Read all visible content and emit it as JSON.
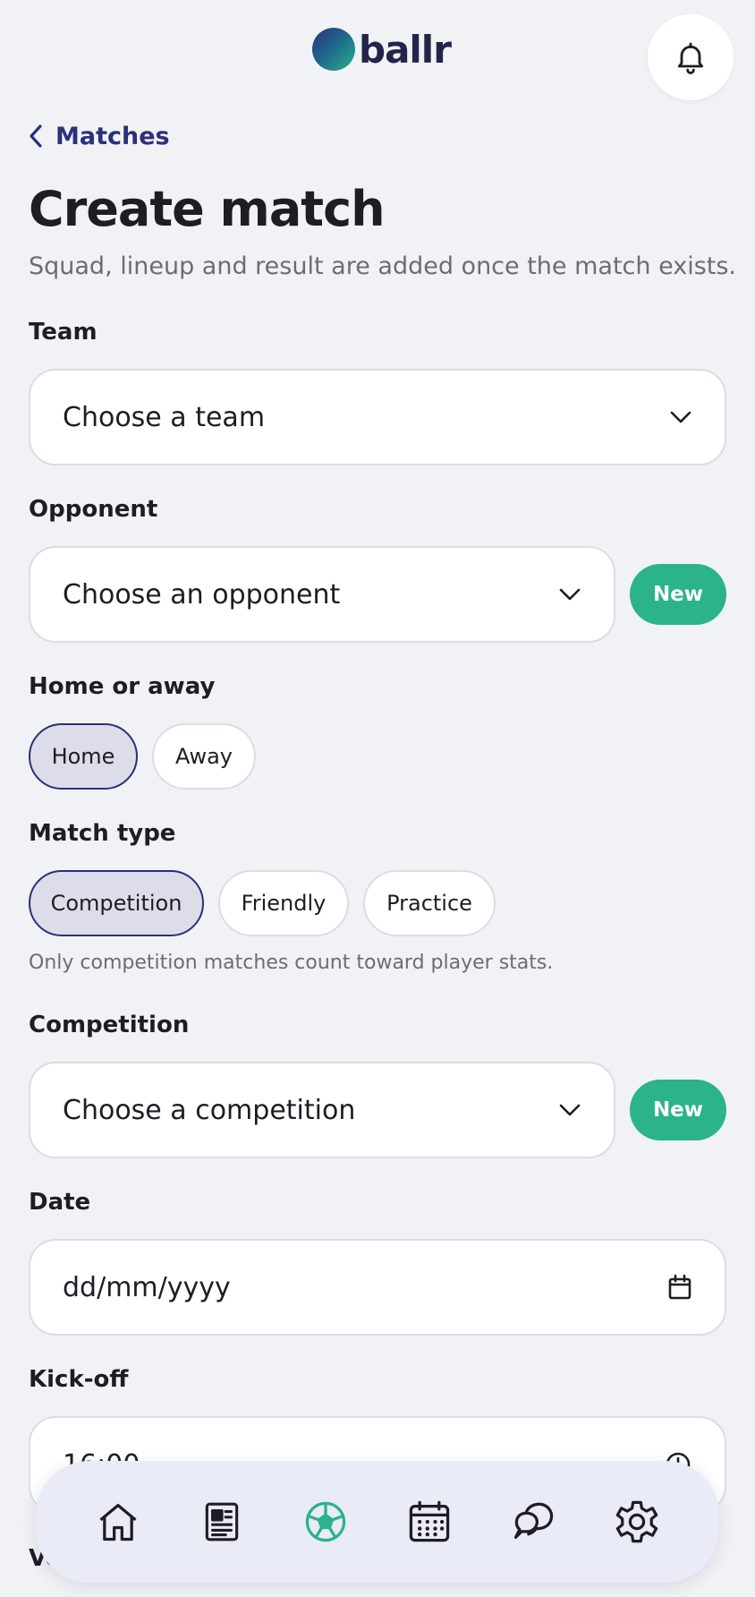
{
  "header": {
    "logo_text": "ballr",
    "notifications_icon": "bell-icon"
  },
  "nav": {
    "back_label": "Matches"
  },
  "page": {
    "title": "Create match",
    "subtitle": "Squad, lineup and result are added once the match exists."
  },
  "form": {
    "team": {
      "label": "Team",
      "placeholder": "Choose a team"
    },
    "opponent": {
      "label": "Opponent",
      "placeholder": "Choose an opponent",
      "new_label": "New"
    },
    "venue_side": {
      "label": "Home or away",
      "options": [
        "Home",
        "Away"
      ],
      "selected": "Home"
    },
    "match_type": {
      "label": "Match type",
      "options": [
        "Competition",
        "Friendly",
        "Practice"
      ],
      "selected": "Competition",
      "hint": "Only competition matches count toward player stats."
    },
    "competition": {
      "label": "Competition",
      "placeholder": "Choose a competition",
      "new_label": "New"
    },
    "date": {
      "label": "Date",
      "placeholder": "dd/mm/yyyy"
    },
    "kickoff": {
      "label": "Kick-off",
      "value": "16:00"
    },
    "next_label_partial": "Ve"
  },
  "bottom_nav": {
    "items": [
      "home-icon",
      "news-icon",
      "ball-icon",
      "calendar-icon",
      "chat-icon",
      "settings-icon"
    ],
    "active": "ball-icon"
  },
  "colors": {
    "accent": "#2c2f7a",
    "green": "#2bb389",
    "background": "#f1f2f5"
  }
}
